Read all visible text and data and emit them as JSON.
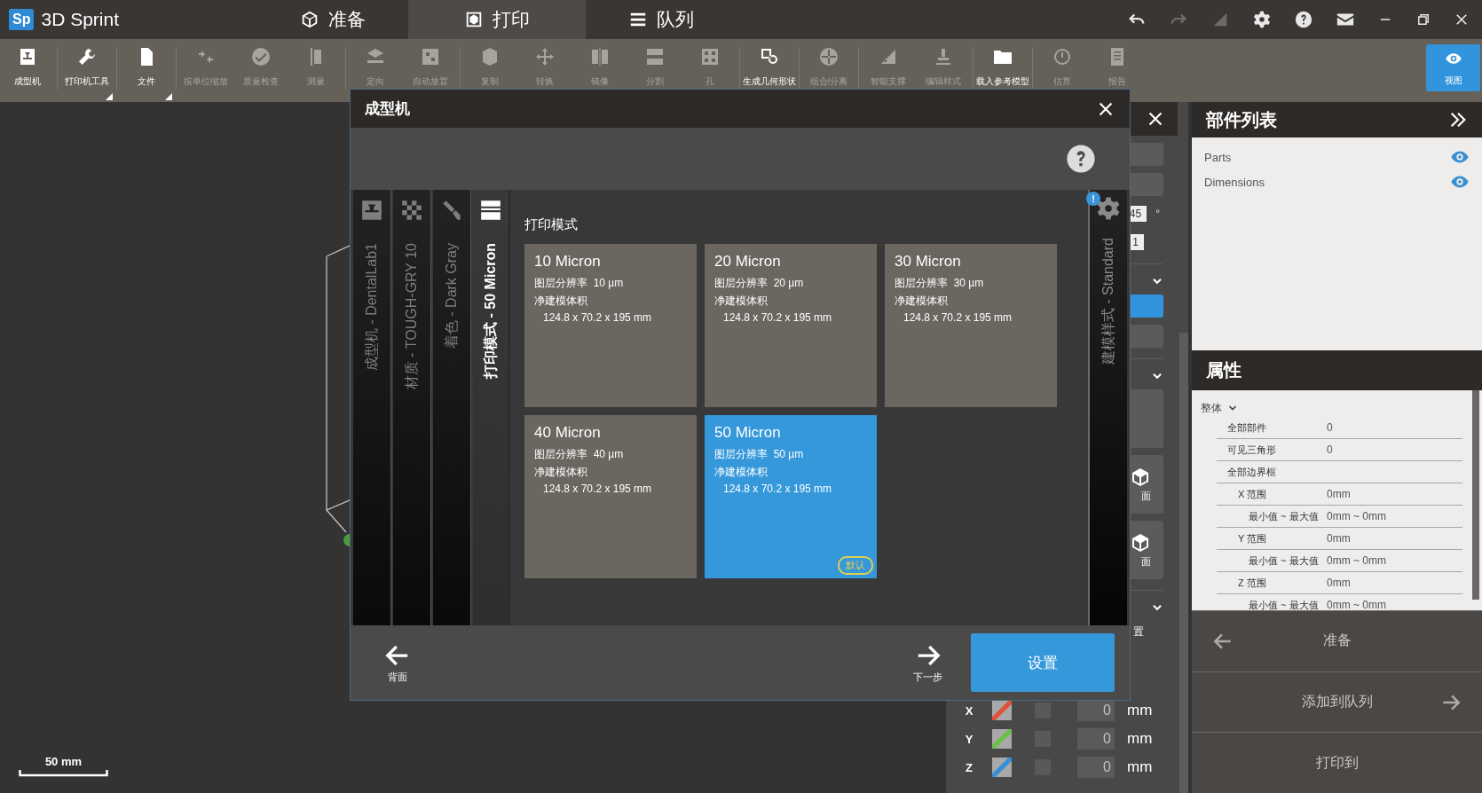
{
  "app": {
    "logo": "Sp",
    "name": "3D Sprint"
  },
  "tabs": [
    {
      "label": "准备",
      "selected": false
    },
    {
      "label": "打印",
      "selected": true
    },
    {
      "label": "队列",
      "selected": false
    }
  ],
  "window_controls": {
    "redo_disabled": true
  },
  "toolbar": [
    [
      {
        "label": "成型机",
        "disabled": false,
        "menu": false
      }
    ],
    [
      {
        "label": "打印机工具",
        "disabled": false,
        "menu": true
      }
    ],
    [
      {
        "label": "文件",
        "disabled": false,
        "menu": true
      }
    ],
    [
      {
        "label": "按单位缩放",
        "disabled": true,
        "menu": false
      },
      {
        "label": "质量检查",
        "disabled": true,
        "menu": false
      },
      {
        "label": "测量",
        "disabled": true,
        "menu": false
      }
    ],
    [
      {
        "label": "定向",
        "disabled": true,
        "menu": false
      },
      {
        "label": "自动放置",
        "disabled": true,
        "menu": false
      }
    ],
    [
      {
        "label": "复制",
        "disabled": true,
        "menu": false
      },
      {
        "label": "转换",
        "disabled": true,
        "menu": false
      },
      {
        "label": "镜像",
        "disabled": true,
        "menu": false
      },
      {
        "label": "分割",
        "disabled": true,
        "menu": false
      },
      {
        "label": "孔",
        "disabled": true,
        "menu": false
      }
    ],
    [
      {
        "label": "生成几何形状",
        "disabled": false,
        "menu": false
      }
    ],
    [
      {
        "label": "组合/分离",
        "disabled": true,
        "menu": false
      }
    ],
    [
      {
        "label": "智能支撑",
        "disabled": true,
        "menu": false
      },
      {
        "label": "编辑样式",
        "disabled": true,
        "menu": false
      }
    ],
    [
      {
        "label": "载入参考模型",
        "disabled": false,
        "menu": false
      }
    ],
    [
      {
        "label": "估算",
        "disabled": true,
        "menu": false
      },
      {
        "label": "报告",
        "disabled": true,
        "menu": false
      }
    ]
  ],
  "view_button": {
    "label": "视图",
    "selected": true
  },
  "viewport": {
    "scale_label": "50 mm"
  },
  "side_panel": {
    "angle": "45",
    "angle_unit": "°",
    "count": "1",
    "face_labels": [
      "面",
      "面"
    ],
    "section_label": "置",
    "axes": [
      {
        "axis": "X",
        "color": "#e0533a",
        "checked": false,
        "value": "0",
        "unit": "mm"
      },
      {
        "axis": "Y",
        "color": "#6cc04a",
        "checked": false,
        "value": "0",
        "unit": "mm"
      },
      {
        "axis": "Z",
        "color": "#3a8fd8",
        "checked": false,
        "value": "0",
        "unit": "mm"
      }
    ]
  },
  "parts_list": {
    "title": "部件列表",
    "items": [
      {
        "label": "Parts",
        "visible": true
      },
      {
        "label": "Dimensions",
        "visible": true
      }
    ]
  },
  "properties": {
    "title": "属性",
    "group": {
      "label": "整体",
      "expanded": true,
      "rows": [
        {
          "label": "全部部件",
          "value": "0"
        },
        {
          "label": "可见三角形",
          "value": "0"
        },
        {
          "label": "全部边界框",
          "children": [
            {
              "label": "X 范围",
              "value": "0mm",
              "children": [
                {
                  "label": "最小值 ~ 最大值",
                  "value": "0mm ~ 0mm"
                }
              ]
            },
            {
              "label": "Y 范围",
              "value": "0mm",
              "children": [
                {
                  "label": "最小值 ~ 最大值",
                  "value": "0mm ~ 0mm"
                }
              ]
            },
            {
              "label": "Z 范围",
              "value": "0mm",
              "children": [
                {
                  "label": "最小值 ~ 最大值",
                  "value": "0mm ~ 0mm"
                }
              ]
            }
          ]
        }
      ]
    }
  },
  "actions": [
    {
      "label": "准备",
      "kind": "back"
    },
    {
      "label": "添加到队列",
      "kind": "forward"
    },
    {
      "label": "打印到",
      "kind": "plain"
    }
  ],
  "dialog": {
    "title": "成型机",
    "steps": [
      {
        "label": "成型机 - DentalLab1",
        "selected": false
      },
      {
        "label": "材质 - TOUGH-GRY 10",
        "selected": false
      },
      {
        "label": "着色 - Dark Gray",
        "selected": false
      },
      {
        "label": "打印模式 - 50 Micron",
        "selected": true
      }
    ],
    "style_step": {
      "label": "建模样式 - Standard",
      "alert": "!"
    },
    "section_title": "打印模式",
    "modes": [
      {
        "title": "10 Micron",
        "resolution_label": "图层分辨率",
        "resolution": "10 µm",
        "volume_label": "净建模体积",
        "volume": "124.8 x 70.2 x 195 mm",
        "selected": false
      },
      {
        "title": "20 Micron",
        "resolution_label": "图层分辨率",
        "resolution": "20 µm",
        "volume_label": "净建模体积",
        "volume": "124.8 x 70.2 x 195 mm",
        "selected": false
      },
      {
        "title": "30 Micron",
        "resolution_label": "图层分辨率",
        "resolution": "30 µm",
        "volume_label": "净建模体积",
        "volume": "124.8 x 70.2 x 195 mm",
        "selected": false
      },
      {
        "title": "40 Micron",
        "resolution_label": "图层分辨率",
        "resolution": "40 µm",
        "volume_label": "净建模体积",
        "volume": "124.8 x 70.2 x 195 mm",
        "selected": false
      },
      {
        "title": "50 Micron",
        "resolution_label": "图层分辨率",
        "resolution": "50 µm",
        "volume_label": "净建模体积",
        "volume": "124.8 x 70.2 x 195 mm",
        "selected": true,
        "badge": "默认"
      }
    ],
    "back": "背面",
    "next": "下一步",
    "confirm": "设置"
  }
}
